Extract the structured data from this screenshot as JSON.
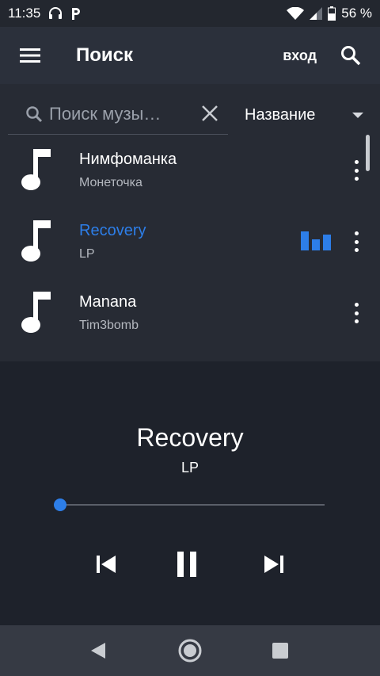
{
  "status_bar": {
    "time": "11:35",
    "battery_text": "56 %"
  },
  "app_bar": {
    "title": "Поиск",
    "login_label": "вход"
  },
  "search": {
    "placeholder": "Поиск музыки",
    "value": "Поиск музы…"
  },
  "sort": {
    "selected": "Название"
  },
  "tracks": [
    {
      "title": "Нимфоманка",
      "artist": "Монеточка",
      "playing": false
    },
    {
      "title": "Recovery",
      "artist": "LP",
      "playing": true
    },
    {
      "title": "Manana",
      "artist": "Tim3bomb",
      "playing": false
    }
  ],
  "player": {
    "title": "Recovery",
    "artist": "LP",
    "progress": 0.0
  },
  "colors": {
    "accent": "#2d7ee8",
    "background": "#1e222b",
    "list_background": "#272b34",
    "app_bar": "#2b303b",
    "nav_bar": "#363a44"
  },
  "icons": [
    "headphones-icon",
    "parking-icon",
    "wifi-icon",
    "signal-icon",
    "battery-icon",
    "menu-icon",
    "search-icon",
    "close-icon",
    "chevron-down-icon",
    "music-note-icon",
    "more-vert-icon",
    "equalizer-icon",
    "skip-previous-icon",
    "pause-icon",
    "skip-next-icon",
    "nav-back-icon",
    "nav-home-icon",
    "nav-recents-icon"
  ]
}
